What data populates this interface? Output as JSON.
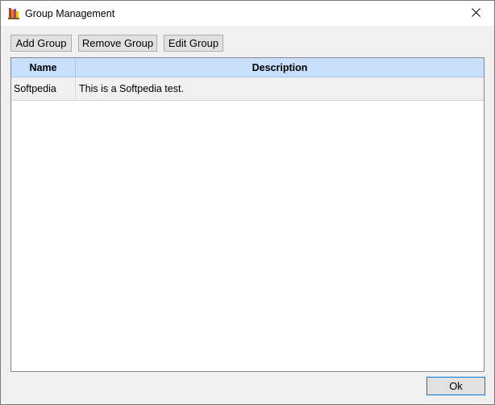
{
  "window": {
    "title": "Group Management"
  },
  "toolbar": {
    "add_label": "Add Group",
    "remove_label": "Remove Group",
    "edit_label": "Edit Group"
  },
  "table": {
    "columns": [
      "Name",
      "Description"
    ],
    "rows": [
      {
        "name": "Softpedia",
        "description": "This is a Softpedia test."
      }
    ]
  },
  "footer": {
    "ok_label": "Ok"
  },
  "colors": {
    "header_bg": "#c7dffb",
    "row_bg": "#f0f0f0",
    "ok_border": "#0078d7"
  },
  "icons": {
    "app": "app-books-icon",
    "close": "close-icon"
  }
}
